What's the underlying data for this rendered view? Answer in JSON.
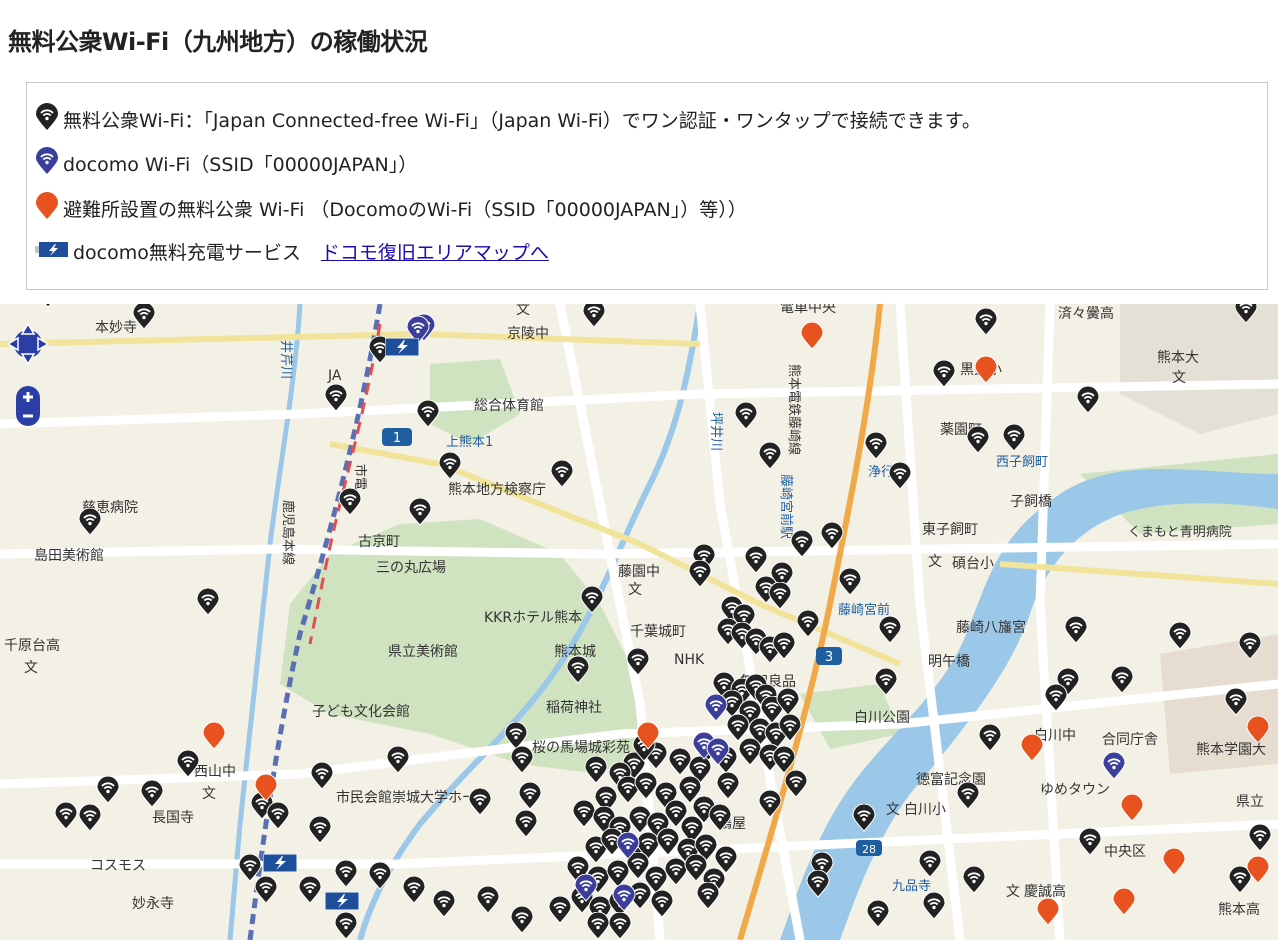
{
  "title": "無料公衆Wi-Fi（九州地方）の稼働状況",
  "legend": {
    "row1": "無料公衆Wi-Fi：「Japan Connected-free Wi-Fi」（Japan Wi-Fi）でワン認証・ワンタップで接続できます。",
    "row2": "docomo Wi-Fi（SSID「00000JAPAN」）",
    "row3": "避難所設置の無料公衆 Wi-Fi （DocomoのWi-Fi（SSID「00000JAPAN」）等））",
    "row4": "docomo無料充電サービス",
    "row4_link": "ドコモ復旧エリアマップへ"
  },
  "colors": {
    "public_wifi": "#222222",
    "docomo_wifi": "#3b3f9b",
    "shelter_wifi": "#e8521f",
    "charge": "#1f4f9a",
    "park": "#cfe3c0",
    "river": "#9bc7e8"
  },
  "map": {
    "labels": [
      {
        "text": "本妙寺",
        "icon": "temple"
      },
      {
        "text": "京陵中",
        "icon": "school"
      },
      {
        "text": "電車中央"
      },
      {
        "text": "済々黌高"
      },
      {
        "text": "熊本大"
      },
      {
        "text": "総合体育館",
        "icon": "building"
      },
      {
        "text": "上熊本1"
      },
      {
        "text": "熊本電鉄藤崎線"
      },
      {
        "text": "黒髪小"
      },
      {
        "text": "薬園町"
      },
      {
        "text": "西子飼町"
      },
      {
        "text": "熊本地方検察庁"
      },
      {
        "text": "浄行寺"
      },
      {
        "text": "子飼橋"
      },
      {
        "text": "慈恵病院"
      },
      {
        "text": "古京町"
      },
      {
        "text": "三の丸広場"
      },
      {
        "text": "藤崎宮前駅"
      },
      {
        "text": "東子飼町"
      },
      {
        "text": "くまもと青明病院"
      },
      {
        "text": "島田美術館",
        "icon": "museum"
      },
      {
        "text": "藤園中"
      },
      {
        "text": "碩台小"
      },
      {
        "text": "藤崎宮前"
      },
      {
        "text": "KKRホテル熊本"
      },
      {
        "text": "千葉城町"
      },
      {
        "text": "藤崎八旛宮"
      },
      {
        "text": "千原台高"
      },
      {
        "text": "県立美術館",
        "icon": "museum"
      },
      {
        "text": "熊本城"
      },
      {
        "text": "NHK"
      },
      {
        "text": "明午橋"
      },
      {
        "text": "無印良品"
      },
      {
        "text": "子ども文化会館"
      },
      {
        "text": "稲荷神社"
      },
      {
        "text": "白川公園"
      },
      {
        "text": "白川中"
      },
      {
        "text": "合同庁舎"
      },
      {
        "text": "熊本学園大"
      },
      {
        "text": "桜の馬場城彩苑"
      },
      {
        "text": "西山中"
      },
      {
        "text": "徳富記念園"
      },
      {
        "text": "ゆめタウン"
      },
      {
        "text": "県立"
      },
      {
        "text": "市民会館崇城大学ホール"
      },
      {
        "text": "長国寺"
      },
      {
        "text": "白川小"
      },
      {
        "text": "中央区"
      },
      {
        "text": "コスモス"
      },
      {
        "text": "九品寺"
      },
      {
        "text": "慶誠高"
      },
      {
        "text": "妙永寺"
      },
      {
        "text": "熊本高"
      },
      {
        "text": "鶴屋"
      },
      {
        "text": "JA"
      },
      {
        "text": "鹿児島本線"
      },
      {
        "text": "坪井川"
      },
      {
        "text": "井芹川"
      },
      {
        "text": "市電"
      },
      {
        "text": "文"
      },
      {
        "text": "1"
      },
      {
        "text": "3"
      },
      {
        "text": "28"
      }
    ],
    "markers": {
      "public_wifi_count": 230,
      "docomo_wifi_count": 9,
      "shelter_wifi_count": 12,
      "charge_count": 3
    }
  }
}
